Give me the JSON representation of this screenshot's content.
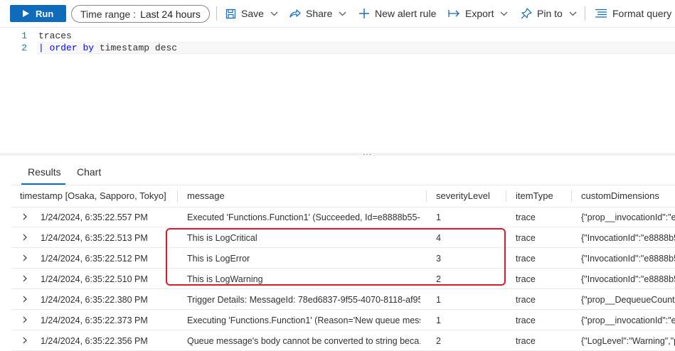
{
  "toolbar": {
    "run_label": "Run",
    "time_range_label": "Time range :",
    "time_range_value": "Last 24 hours",
    "save_label": "Save",
    "share_label": "Share",
    "new_alert_label": "New alert rule",
    "export_label": "Export",
    "pin_label": "Pin to",
    "format_label": "Format query"
  },
  "editor": {
    "lines": [
      {
        "number": "1",
        "text": "traces"
      },
      {
        "number": "2",
        "pipe": "|",
        "kw1": "order",
        "kw2": "by",
        "rest": "timestamp desc"
      }
    ]
  },
  "tabs": [
    {
      "label": "Results",
      "active": true
    },
    {
      "label": "Chart",
      "active": false
    }
  ],
  "table": {
    "columns": [
      "timestamp [Osaka, Sapporo, Tokyo]",
      "message",
      "severityLevel",
      "itemType",
      "customDimensions"
    ],
    "rows": [
      {
        "timestamp": "1/24/2024, 6:35:22.557 PM",
        "message": "Executed 'Functions.Function1' (Succeeded, Id=e8888b55-b...",
        "severity": "1",
        "itemType": "trace",
        "custom": "{\"prop__invocationId\":\"e8"
      },
      {
        "timestamp": "1/24/2024, 6:35:22.513 PM",
        "message": "This is LogCritical",
        "severity": "4",
        "itemType": "trace",
        "custom": "{\"InvocationId\":\"e8888b5"
      },
      {
        "timestamp": "1/24/2024, 6:35:22.512 PM",
        "message": "This is LogError",
        "severity": "3",
        "itemType": "trace",
        "custom": "{\"InvocationId\":\"e8888b5"
      },
      {
        "timestamp": "1/24/2024, 6:35:22.510 PM",
        "message": "This is LogWarning",
        "severity": "2",
        "itemType": "trace",
        "custom": "{\"InvocationId\":\"e8888b5"
      },
      {
        "timestamp": "1/24/2024, 6:35:22.380 PM",
        "message": "Trigger Details: MessageId: 78ed6837-9f55-4070-8118-af95...",
        "severity": "1",
        "itemType": "trace",
        "custom": "{\"prop__DequeueCount\":"
      },
      {
        "timestamp": "1/24/2024, 6:35:22.373 PM",
        "message": "Executing 'Functions.Function1' (Reason='New queue mess...",
        "severity": "1",
        "itemType": "trace",
        "custom": "{\"prop__invocationId\":\"e8"
      },
      {
        "timestamp": "1/24/2024, 6:35:22.356 PM",
        "message": "Queue message's body cannot be converted to string beca...",
        "severity": "2",
        "itemType": "trace",
        "custom": "{\"LogLevel\":\"Warning\",\"p"
      }
    ]
  },
  "colors": {
    "accent": "#0f6cbd",
    "highlight_border": "#e0192a",
    "keyword": "#0000ff"
  }
}
